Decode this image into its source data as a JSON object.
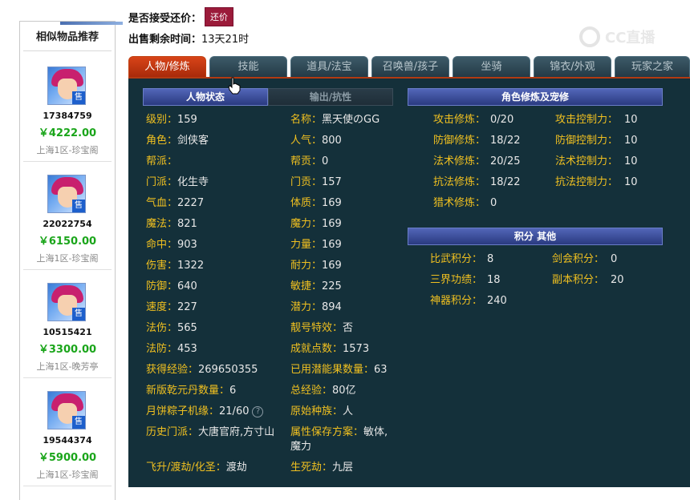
{
  "sidebar": {
    "title": "相似物品推荐",
    "items": [
      {
        "id": "17384759",
        "price": "￥4222.00",
        "server": "上海1区-珍宝阁",
        "badge": "售"
      },
      {
        "id": "22022754",
        "price": "￥6150.00",
        "server": "上海1区-珍宝阁",
        "badge": "售"
      },
      {
        "id": "10515421",
        "price": "￥3300.00",
        "server": "上海1区-晚芳亭",
        "badge": "售"
      },
      {
        "id": "19544374",
        "price": "￥5900.00",
        "server": "上海1区-珍宝阁",
        "badge": "售"
      }
    ]
  },
  "header": {
    "bargain_label": "是否接受还价：",
    "bargain_button": "还价",
    "time_label": "出售剩余时间：",
    "time_value": "13天21时",
    "watermark": "CC直播"
  },
  "tabs": [
    "人物/修炼",
    "技能",
    "道具/法宝",
    "召唤兽/孩子",
    "坐骑",
    "锦衣/外观",
    "玩家之家"
  ],
  "panel": {
    "left_tabs": [
      "人物状态",
      "输出/抗性"
    ],
    "right_head_1": "角色修炼及宠修",
    "right_head_2": "积分 其他",
    "help_icon": "?",
    "left_col1": [
      {
        "label": "级别：",
        "value": "159"
      },
      {
        "label": "角色：",
        "value": "剑侠客"
      },
      {
        "label": "帮派：",
        "value": ""
      },
      {
        "label": "门派：",
        "value": "化生寺"
      },
      {
        "label": "气血：",
        "value": "2227"
      },
      {
        "label": "魔法：",
        "value": "821"
      },
      {
        "label": "命中：",
        "value": "903"
      },
      {
        "label": "伤害：",
        "value": "1322"
      },
      {
        "label": "防御：",
        "value": "640"
      },
      {
        "label": "速度：",
        "value": "227"
      },
      {
        "label": "法伤：",
        "value": "565"
      },
      {
        "label": "法防：",
        "value": "453"
      },
      {
        "label": "获得经验：",
        "value": "269650355"
      },
      {
        "label": "新版乾元丹数量：",
        "value": "6"
      },
      {
        "label": "月饼粽子机缘：",
        "value": "21/60"
      },
      {
        "label": "历史门派：",
        "value": "大唐官府,方寸山"
      },
      {
        "label": "飞升/渡劫/化圣：",
        "value": "渡劫"
      }
    ],
    "left_col2": [
      {
        "label": "名称：",
        "value": "黑天使のGG"
      },
      {
        "label": "人气：",
        "value": "800"
      },
      {
        "label": "帮贡：",
        "value": "0"
      },
      {
        "label": "门贡：",
        "value": "157"
      },
      {
        "label": "体质：",
        "value": "169"
      },
      {
        "label": "魔力：",
        "value": "169"
      },
      {
        "label": "力量：",
        "value": "169"
      },
      {
        "label": "耐力：",
        "value": "169"
      },
      {
        "label": "敏捷：",
        "value": "225"
      },
      {
        "label": "潜力：",
        "value": "894"
      },
      {
        "label": "靓号特效：",
        "value": "否"
      },
      {
        "label": "成就点数：",
        "value": "1573"
      },
      {
        "label": "已用潜能果数量：",
        "value": "63"
      },
      {
        "label": "总经验：",
        "value": "80亿"
      },
      {
        "label": "原始种族：",
        "value": "人"
      },
      {
        "label": "属性保存方案：",
        "value": "敏体,魔力"
      },
      {
        "label": "生死劫：",
        "value": "九层"
      }
    ],
    "cultivation_col1": [
      {
        "label": "攻击修炼：",
        "value": "0/20"
      },
      {
        "label": "防御修炼：",
        "value": "18/22"
      },
      {
        "label": "法术修炼：",
        "value": "20/25"
      },
      {
        "label": "抗法修炼：",
        "value": "18/22"
      },
      {
        "label": "猎术修炼：",
        "value": "0"
      }
    ],
    "cultivation_col2": [
      {
        "label": "攻击控制力：",
        "value": "10"
      },
      {
        "label": "防御控制力：",
        "value": "10"
      },
      {
        "label": "法术控制力：",
        "value": "10"
      },
      {
        "label": "抗法控制力：",
        "value": "10"
      }
    ],
    "score_col1": [
      {
        "label": "比武积分：",
        "value": "8"
      },
      {
        "label": "三界功绩：",
        "value": "18"
      },
      {
        "label": "神器积分：",
        "value": "240"
      }
    ],
    "score_col2": [
      {
        "label": "剑会积分：",
        "value": "0"
      },
      {
        "label": "副本积分：",
        "value": "20"
      }
    ]
  },
  "colors": {
    "label": "#f0c020",
    "value": "#e8e8e8",
    "panel_bg": "#14303a",
    "active_tab": "#c43a12",
    "price": "#1aa51a"
  }
}
